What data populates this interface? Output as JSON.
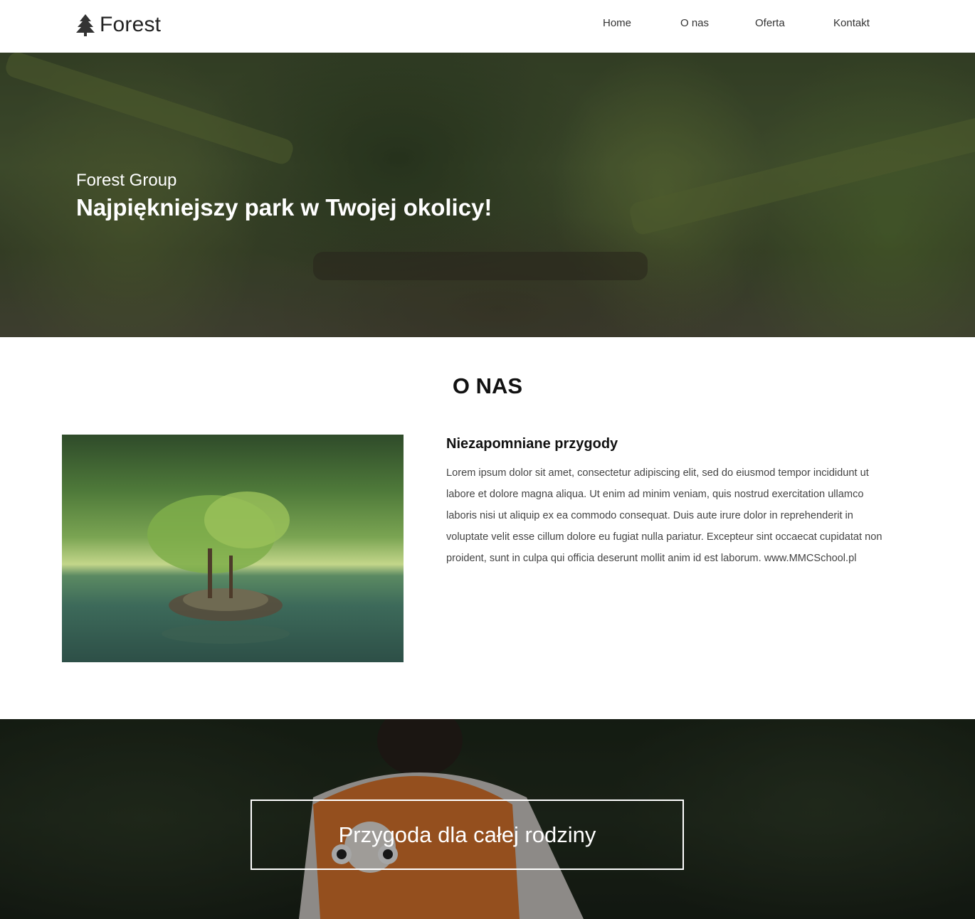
{
  "brand": {
    "name": "Forest",
    "icon": "tree-icon"
  },
  "nav": {
    "items": [
      "Home",
      "O nas",
      "Oferta",
      "Kontakt"
    ]
  },
  "hero": {
    "subtitle": "Forest Group",
    "title": "Najpiękniejszy park w Twojej okolicy!"
  },
  "about": {
    "heading": "O NAS",
    "card_title": "Niezapomniane przygody",
    "card_text": "Lorem ipsum dolor sit amet, consectetur adipiscing elit, sed do eiusmod tempor incididunt ut labore et dolore magna aliqua. Ut enim ad minim veniam, quis nostrud exercitation ullamco laboris nisi ut aliquip ex ea commodo consequat. Duis aute irure dolor in reprehenderit in voluptate velit esse cillum dolore eu fugiat nulla pariatur. Excepteur sint occaecat cupidatat non proident, sunt in culpa qui officia deserunt mollit anim id est laborum. www.MMCSchool.pl"
  },
  "cta": {
    "label": "Przygoda dla całej rodziny"
  },
  "colors": {
    "nav_bg": "#ffffff",
    "text_dark": "#111111",
    "body_text": "#444444",
    "hero_text": "#ffffff"
  }
}
